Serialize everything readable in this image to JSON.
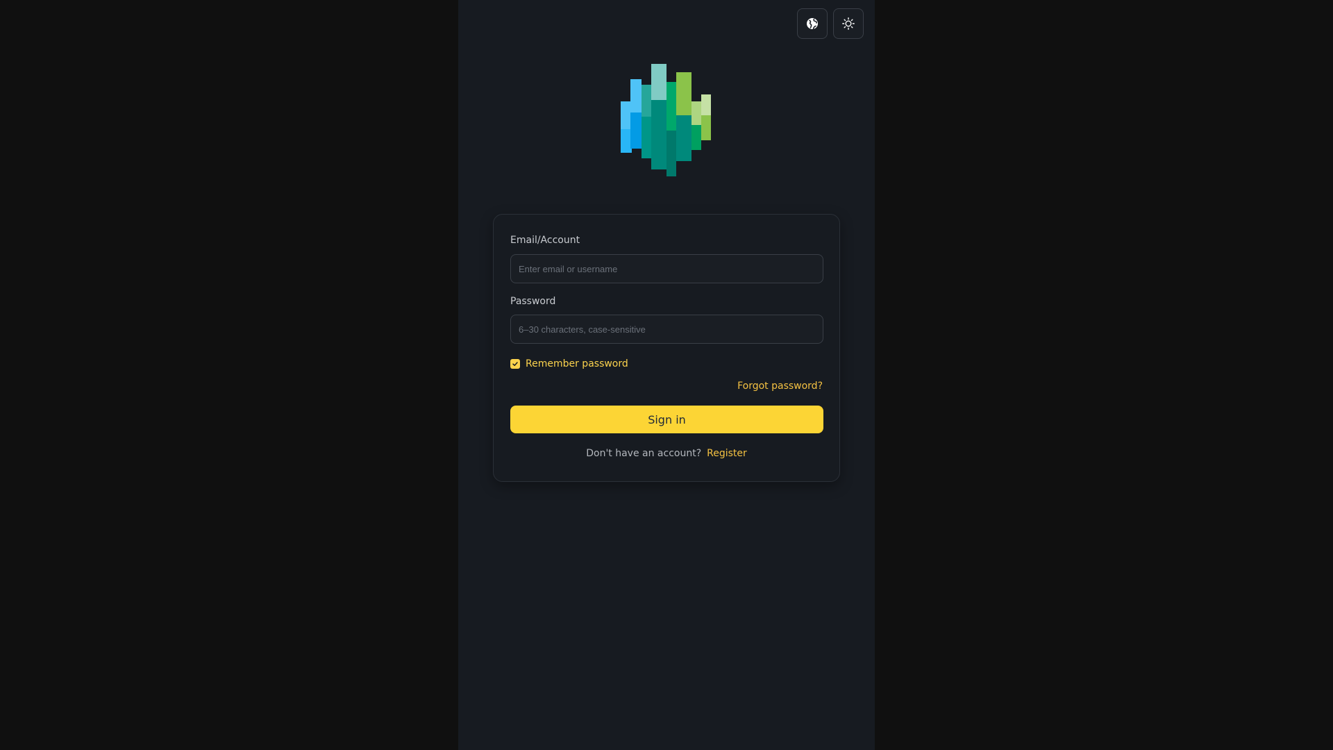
{
  "header": {
    "language_icon": "globe-icon",
    "theme_icon": "sun-icon"
  },
  "logo": {
    "icon": "bar-cluster-logo",
    "colors": [
      "#4fc3f7",
      "#29b6f6",
      "#26c6da",
      "#80cbc4",
      "#009688",
      "#00897b",
      "#8bc34a",
      "#aed581",
      "#c5e1a5"
    ]
  },
  "login": {
    "email_label": "Email/Account",
    "email_placeholder": "Enter email or username",
    "email_value": "",
    "password_label": "Password",
    "password_placeholder": "6–30 characters, case-sensitive",
    "password_value": "",
    "remember_label": "Remember password",
    "remember_checked": true,
    "forgot_label": "Forgot password?",
    "signin_label": "Sign in",
    "no_account_text": "Don't have an account?",
    "register_label": "Register"
  },
  "colors": {
    "accent": "#fcd535",
    "background": "#101010",
    "panel": "#171b21"
  }
}
